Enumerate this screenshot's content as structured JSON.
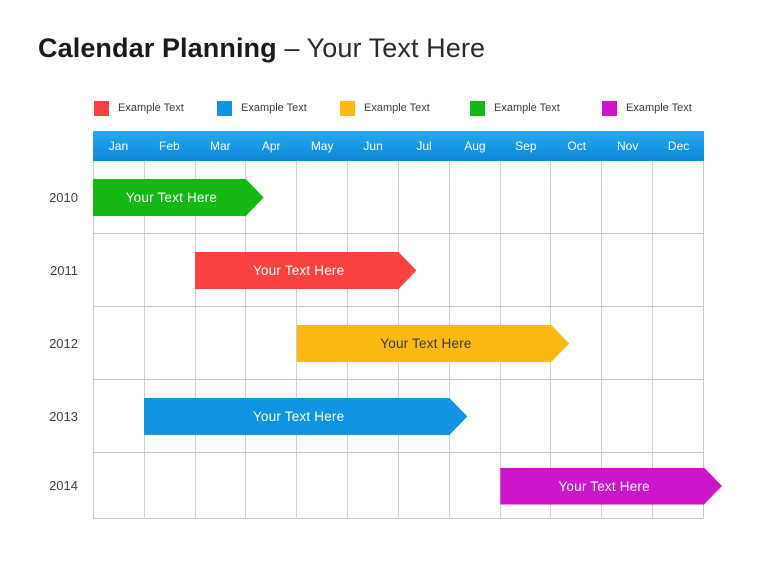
{
  "title": {
    "bold_part": "Calendar  Planning",
    "light_part": " – Your Text Here"
  },
  "colors": {
    "red": "#F94141",
    "blue": "#1093E0",
    "yellow": "#FCB813",
    "green": "#14B714",
    "magenta": "#CC16CC",
    "header_blue_top": "#2AA7EF",
    "header_blue_bottom": "#0D86D8",
    "grid_line": "#C8C8C8",
    "year_text": "#3F3F3F",
    "legend_text": "#3C3C3C"
  },
  "legend": {
    "items": [
      {
        "label": "Example Text",
        "color": "#F94141",
        "swatch_name": "legend-swatch-red"
      },
      {
        "label": "Example Text",
        "color": "#1093E0",
        "swatch_name": "legend-swatch-blue"
      },
      {
        "label": "Example Text",
        "color": "#FCB813",
        "swatch_name": "legend-swatch-yellow"
      },
      {
        "label": "Example Text",
        "color": "#14B714",
        "swatch_name": "legend-swatch-green"
      },
      {
        "label": "Example Text",
        "color": "#CC16CC",
        "swatch_name": "legend-swatch-magenta"
      }
    ]
  },
  "months": [
    "Jan",
    "Feb",
    "Mar",
    "Apr",
    "May",
    "Jun",
    "Jul",
    "Aug",
    "Sep",
    "Oct",
    "Nov",
    "Dec"
  ],
  "years": [
    "2010",
    "2011",
    "2012",
    "2013",
    "2014"
  ],
  "bars": [
    {
      "year": "2010",
      "label": "Your  Text Here",
      "color": "#14B714",
      "text_color": "#FFFFFF"
    },
    {
      "year": "2011",
      "label": "Your  Text Here",
      "color": "#F94141",
      "text_color": "#FFFFFF"
    },
    {
      "year": "2012",
      "label": "Your  Text Here",
      "color": "#FCB813",
      "text_color": "#3A3A3A"
    },
    {
      "year": "2013",
      "label": "Your  Text Here",
      "color": "#1093E0",
      "text_color": "#FFFFFF"
    },
    {
      "year": "2014",
      "label": "Your  Text Here",
      "color": "#CC16CC",
      "text_color": "#FFFFFF"
    }
  ],
  "chart_data": {
    "type": "bar",
    "title": "Calendar  Planning – Your Text Here",
    "xlabel": "",
    "ylabel": "",
    "orientation": "horizontal",
    "categories": [
      "2010",
      "2011",
      "2012",
      "2013",
      "2014"
    ],
    "x_categories": [
      "Jan",
      "Feb",
      "Mar",
      "Apr",
      "May",
      "Jun",
      "Jul",
      "Aug",
      "Sep",
      "Oct",
      "Nov",
      "Dec"
    ],
    "grid": true,
    "legend": "top",
    "legend_entries": [
      "Example Text",
      "Example Text",
      "Example Text",
      "Example Text",
      "Example Text"
    ],
    "series": [
      {
        "name": "2010",
        "label": "Your  Text Here",
        "color": "#14B714",
        "start_month": "Jan",
        "end_month": "Mar",
        "start_index": 0,
        "end_index": 3,
        "duration_months": 3
      },
      {
        "name": "2011",
        "label": "Your  Text Here",
        "color": "#F94141",
        "start_month": "Mar",
        "end_month": "Jun",
        "start_index": 2,
        "end_index": 6,
        "duration_months": 4
      },
      {
        "name": "2012",
        "label": "Your  Text Here",
        "color": "#FCB813",
        "start_month": "May",
        "end_month": "Oct",
        "start_index": 4,
        "end_index": 9,
        "duration_months": 5
      },
      {
        "name": "2013",
        "label": "Your  Text Here",
        "color": "#1093E0",
        "start_month": "Feb",
        "end_month": "Jul",
        "start_index": 1,
        "end_index": 7,
        "duration_months": 6
      },
      {
        "name": "2014",
        "label": "Your  Text Here",
        "color": "#CC16CC",
        "start_month": "Sep",
        "end_month": "Dec",
        "start_index": 8,
        "end_index": 12,
        "duration_months": 4
      }
    ]
  }
}
